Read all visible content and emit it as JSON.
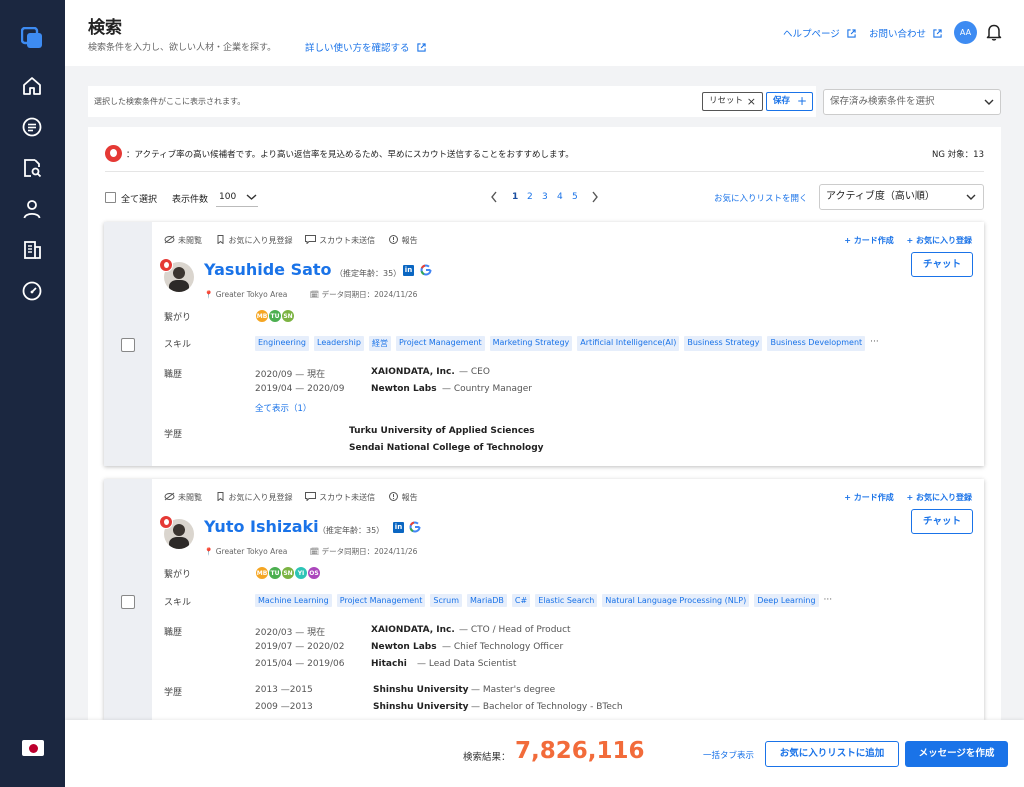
{
  "sidebar": {
    "icons": [
      "home-icon",
      "list-icon",
      "search-doc-icon",
      "user-icon",
      "building-icon",
      "gauge-icon"
    ],
    "language_flag": "japan-flag"
  },
  "header": {
    "title": "検索",
    "subtitle": "検索条件を入力し、欲しい人材・企業を探す。",
    "howto_link": "詳しい使い方を確認する",
    "help_link": "ヘルプページ",
    "contact_link": "お問い合わせ",
    "avatar_initials": "AA"
  },
  "filterbar": {
    "placeholder_text": "選択した検索条件がここに表示されます。",
    "reset_label": "リセット",
    "save_label": "保存",
    "saved_conditions_placeholder": "保存済み検索条件を選択"
  },
  "results": {
    "notice": "：アクティブ率の高い候補者です。より高い返信率を見込めるため、早めにスカウト送信することをおすすめします。",
    "ng_count_label": "NG 対象：13",
    "select_all_label": "全て選択",
    "per_page_label": "表示件数",
    "per_page_value": "100",
    "pages": [
      "1",
      "2",
      "3",
      "4",
      "5"
    ],
    "current_page": "1",
    "open_favorites_label": "お気に入りリストを開く",
    "sort_value": "アクティブ度（高い順）"
  },
  "card_common": {
    "status_unviewed": "未閲覧",
    "status_fav": "お気に入り見登録",
    "status_scout": "スカウト未送信",
    "status_report": "報告",
    "create_card": "+ カード作成",
    "add_fav": "+ お気に入り登録",
    "chat_label": "チャット",
    "connections_label": "繋がり",
    "skills_label": "スキル",
    "career_label": "職歴",
    "education_label": "学歴",
    "more": "···"
  },
  "candidates": [
    {
      "name": "Yasuhide Sato",
      "age": "（推定年齢：35）",
      "location": "Greater Tokyo Area",
      "sync_date": "データ同期日：2024/11/26",
      "connections": [
        {
          "label": "MB",
          "color": "#f5a623"
        },
        {
          "label": "TU",
          "color": "#4caf50"
        },
        {
          "label": "SN",
          "color": "#7cb342"
        }
      ],
      "skills": [
        "Engineering",
        "Leadership",
        "経営",
        "Project Management",
        "Marketing Strategy",
        "Artificial Intelligence(AI)",
        "Business Strategy",
        "Business Development"
      ],
      "career": [
        {
          "date": "2020/09 — 現在",
          "company": "XAIONDATA, Inc.",
          "role": "— CEO"
        },
        {
          "date": "2019/04 — 2020/09",
          "company": "Newton Labs",
          "role": "— Country Manager"
        }
      ],
      "show_all": "全て表示（1）",
      "education": [
        {
          "date": "",
          "school": "Turku University of Applied Sciences",
          "degree": ""
        },
        {
          "date": "",
          "school": "Sendai National College of Technology",
          "degree": ""
        }
      ]
    },
    {
      "name": "Yuto Ishizaki",
      "age": "（推定年齢：35）",
      "location": "Greater Tokyo Area",
      "sync_date": "データ同期日：2024/11/26",
      "connections": [
        {
          "label": "MB",
          "color": "#f5a623"
        },
        {
          "label": "TU",
          "color": "#4caf50"
        },
        {
          "label": "SN",
          "color": "#7cb342"
        },
        {
          "label": "YI",
          "color": "#2ec4b6"
        },
        {
          "label": "OS",
          "color": "#ab47bc"
        }
      ],
      "skills": [
        "Machine Learning",
        "Project Management",
        "Scrum",
        "MariaDB",
        "C#",
        "Elastic Search",
        "Natural Language Processing (NLP)",
        "Deep Learning"
      ],
      "career": [
        {
          "date": "2020/03 — 現在",
          "company": "XAIONDATA, Inc.",
          "role": "— CTO / Head of Product"
        },
        {
          "date": "2019/07 — 2020/02",
          "company": "Newton Labs",
          "role": "— Chief Technology Officer"
        },
        {
          "date": "2015/04 — 2019/06",
          "company": "Hitachi",
          "role": "— Lead Data Scientist"
        }
      ],
      "education": [
        {
          "date": "2013 —2015",
          "school": "Shinshu University",
          "degree": "— Master's degree"
        },
        {
          "date": "2009 —2013",
          "school": "Shinshu University",
          "degree": "— Bachelor of Technology - BTech"
        }
      ]
    }
  ],
  "footer": {
    "result_label": "検索結果：",
    "result_count": "7,826,116",
    "bulk_tab_label": "一括タブ表示",
    "add_fav_label": "お気に入りリストに追加",
    "create_msg_label": "メッセージを作成"
  },
  "colors": {
    "sidebar": "#1b2740",
    "accent": "#1a73e8",
    "count": "#f26b3a",
    "active_flame": "#e53935"
  }
}
